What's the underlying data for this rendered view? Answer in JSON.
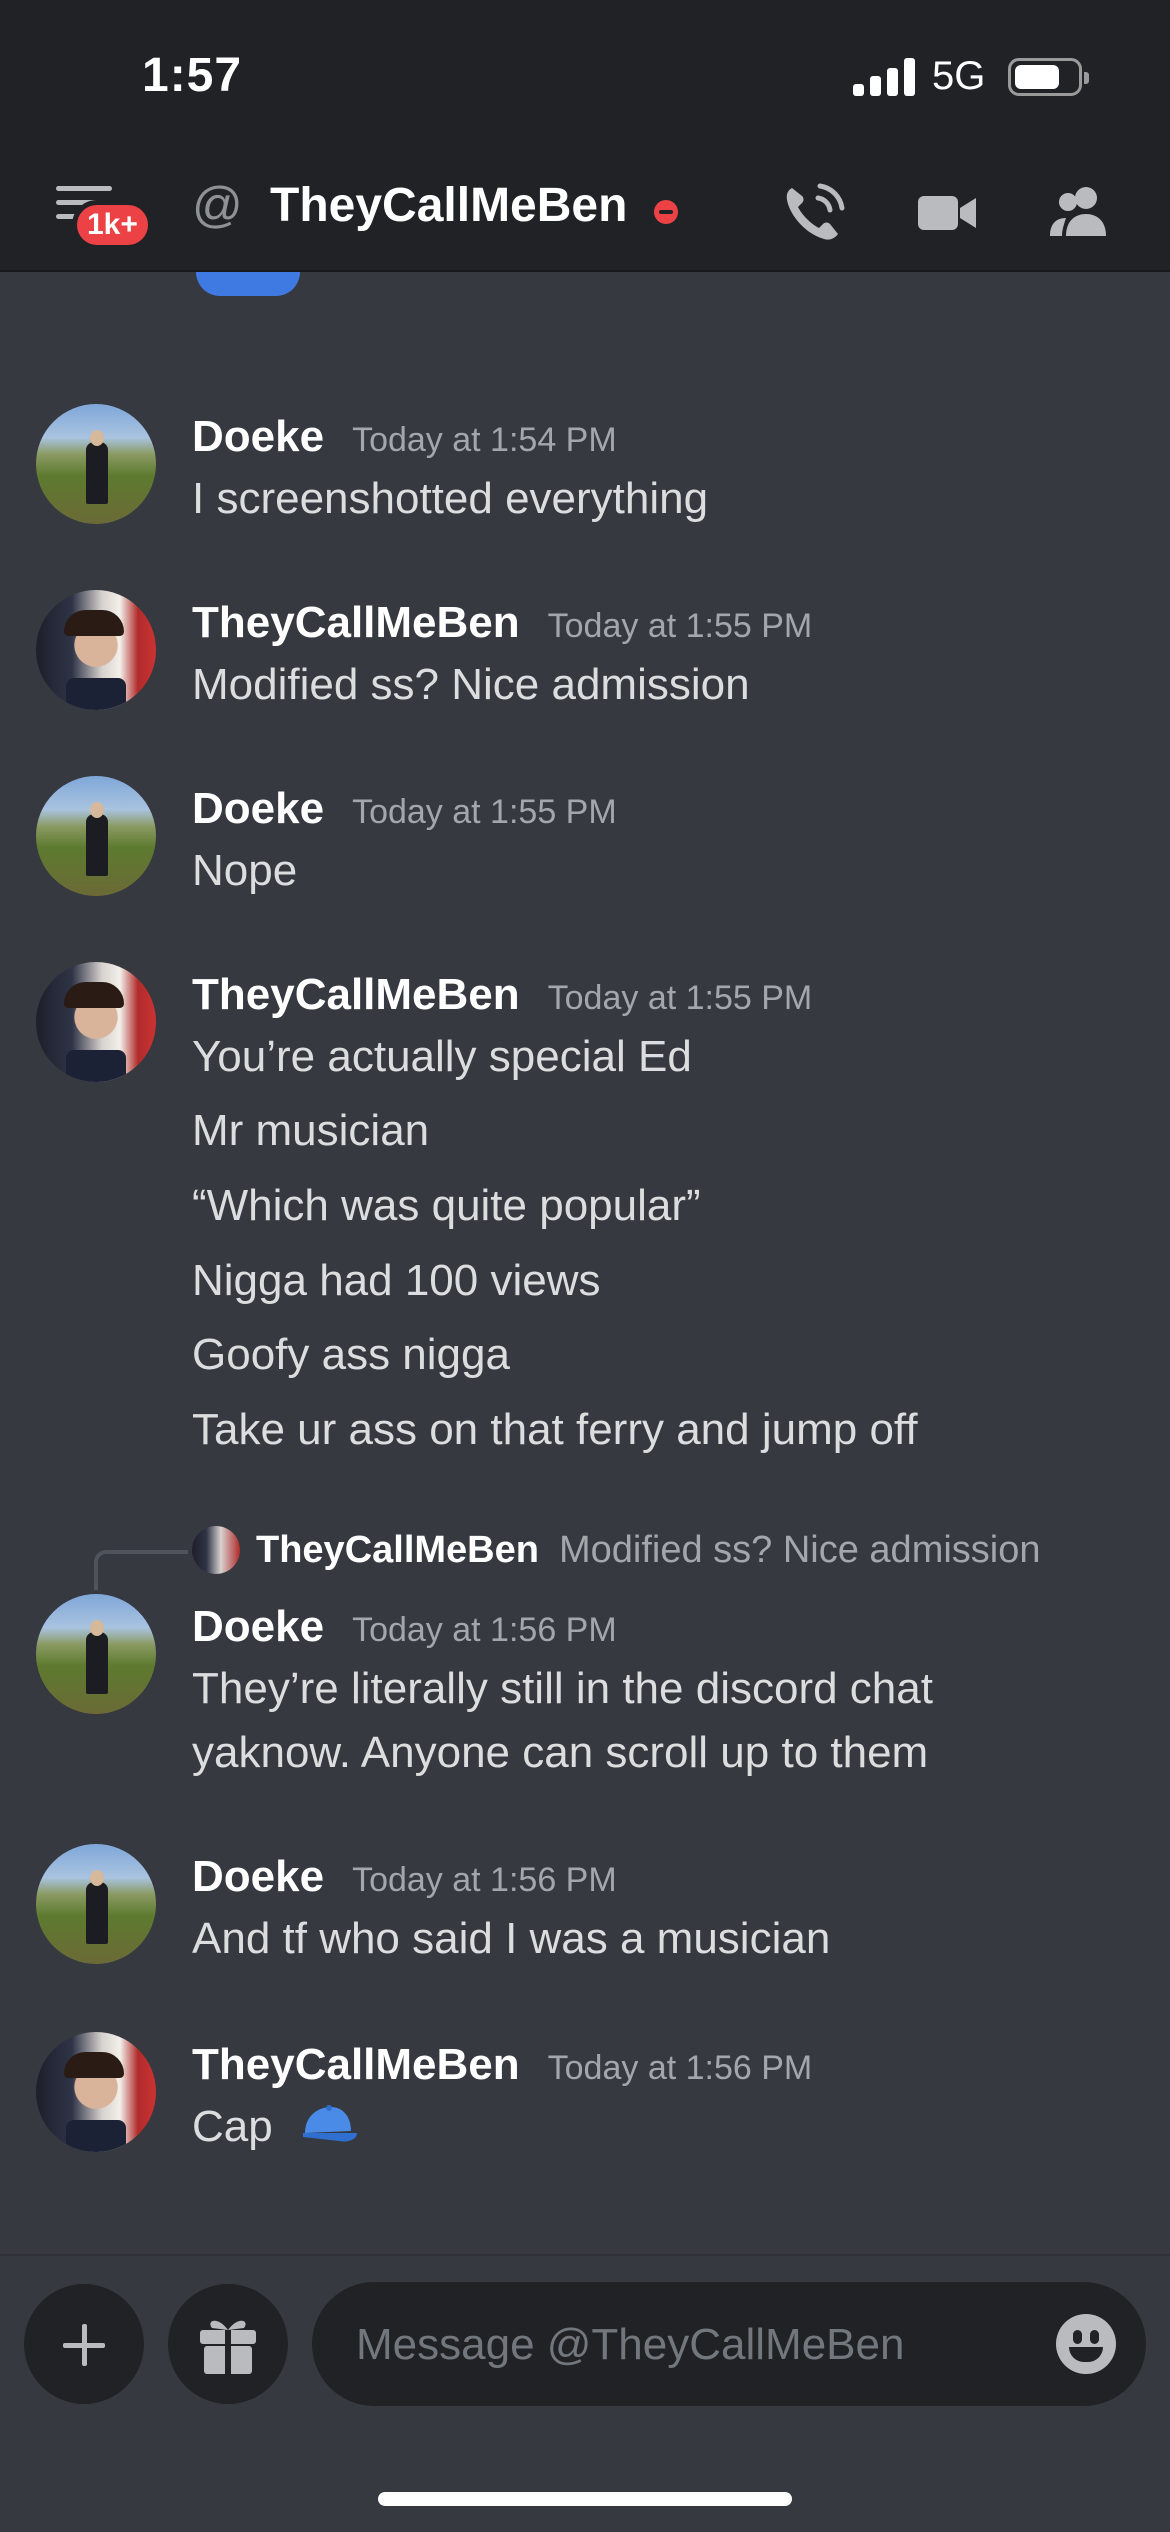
{
  "status_bar": {
    "time": "1:57",
    "network": "5G"
  },
  "header": {
    "badge": "1k+",
    "at_symbol": "@",
    "title": "TheyCallMeBen",
    "presence": "dnd",
    "icons": [
      "menu-icon",
      "phone-icon",
      "video-icon",
      "members-icon"
    ]
  },
  "messages": [
    {
      "author": "Doeke",
      "avatar": "doeke",
      "time": "Today at 1:54 PM",
      "lines": [
        "I screenshotted everything"
      ]
    },
    {
      "author": "TheyCallMeBen",
      "avatar": "ben",
      "time": "Today at 1:55 PM",
      "lines": [
        "Modified ss? Nice admission"
      ]
    },
    {
      "author": "Doeke",
      "avatar": "doeke",
      "time": "Today at 1:55 PM",
      "lines": [
        "Nope"
      ]
    },
    {
      "author": "TheyCallMeBen",
      "avatar": "ben",
      "time": "Today at 1:55 PM",
      "lines": [
        "You’re actually special Ed",
        "Mr musician",
        "“Which was quite popular”",
        "Nigga had 100 views",
        "Goofy ass nigga",
        "Take ur ass on that ferry and jump off"
      ]
    },
    {
      "reply_to": {
        "author": "TheyCallMeBen",
        "text": "Modified ss? Nice admission"
      },
      "author": "Doeke",
      "avatar": "doeke",
      "time": "Today at 1:56 PM",
      "lines": [
        "They’re literally still in the discord chat",
        "yaknow. Anyone can scroll up to them"
      ]
    },
    {
      "author": "Doeke",
      "avatar": "doeke",
      "time": "Today at 1:56 PM",
      "lines": [
        "And tf who said I was a musician"
      ]
    },
    {
      "author": "TheyCallMeBen",
      "avatar": "ben",
      "time": "Today at 1:56 PM",
      "lines": [
        "Cap"
      ],
      "emoji": "blue-cap"
    }
  ],
  "composer": {
    "placeholder": "Message @TheyCallMeBen"
  },
  "colors": {
    "background": "#36393f",
    "header": "#202225",
    "accent_red": "#ed4245",
    "text": "#dcddde",
    "muted": "#a3a6aa"
  }
}
